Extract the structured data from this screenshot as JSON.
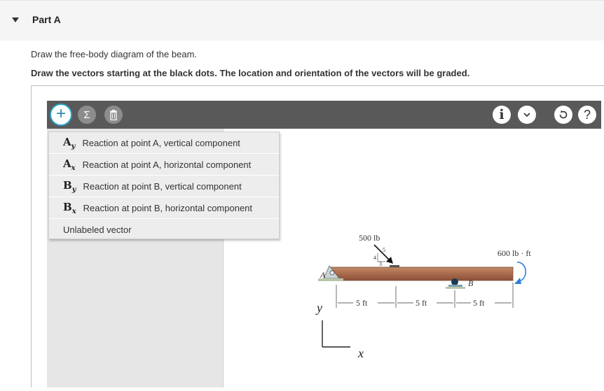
{
  "part": {
    "title": "Part A"
  },
  "instructions": {
    "line1": "Draw the free-body diagram of the beam.",
    "line2": "Draw the vectors starting at the black dots. The location and orientation of the vectors will be graded."
  },
  "toolbar": {
    "add": "+",
    "sigma": "Σ",
    "info": "i",
    "help": "?"
  },
  "menu": {
    "items": [
      {
        "sym": "A",
        "sub": "y",
        "label": "Reaction at point A, vertical component"
      },
      {
        "sym": "A",
        "sub": "x",
        "label": "Reaction at point A, horizontal component"
      },
      {
        "sym": "B",
        "sub": "y",
        "label": "Reaction at point B, vertical component"
      },
      {
        "sym": "B",
        "sub": "x",
        "label": "Reaction at point B, horizontal component"
      }
    ],
    "unlabeled": "Unlabeled vector"
  },
  "diagram": {
    "force_label": "500 lb",
    "slope_hyp": "5",
    "slope_rise": "4",
    "slope_run": "3",
    "moment_label": "600 lb · ft",
    "point_a": "A",
    "point_b": "B",
    "dim1": "5 ft",
    "dim2": "5 ft",
    "dim3": "5 ft",
    "axis_y": "y",
    "axis_x": "x"
  }
}
